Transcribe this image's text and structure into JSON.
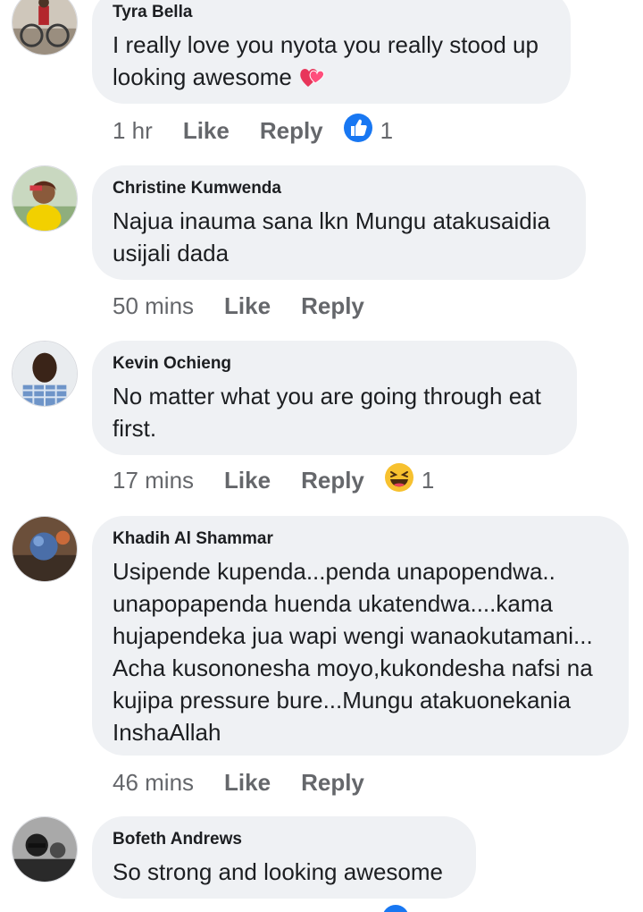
{
  "comments": [
    {
      "author": "Tyra Bella",
      "lines": [
        "I really love you nyota you really stood up",
        "looking awesome"
      ],
      "inline_emoji": "heart-icon",
      "time": "1 hr",
      "like_label": "Like",
      "reply_label": "Reply",
      "reaction": "like-icon",
      "reaction_count": "1"
    },
    {
      "author": "Christine Kumwenda",
      "lines": [
        "Najua inauma sana lkn Mungu atakusaidia",
        "usijali dada"
      ],
      "time": "50 mins",
      "like_label": "Like",
      "reply_label": "Reply"
    },
    {
      "author": "Kevin Ochieng",
      "lines": [
        "No matter what you are going through eat",
        "first."
      ],
      "time": "17 mins",
      "like_label": "Like",
      "reply_label": "Reply",
      "reaction": "haha-icon",
      "reaction_count": "1"
    },
    {
      "author": "Khadih Al Shammar",
      "lines": [
        "Usipende kupenda...penda unapopendwa..",
        "unapopapenda huenda ukatendwa....kama",
        "hujapendeka jua wapi wengi wanaokutamani...",
        "Acha kusononesha moyo,kukondesha nafsi na",
        "kujipa pressure bure...Mungu atakuonekania",
        "InshaAllah"
      ],
      "time": "46 mins",
      "like_label": "Like",
      "reply_label": "Reply"
    },
    {
      "author": "Bofeth Andrews",
      "lines": [
        "So strong and looking awesome"
      ]
    }
  ],
  "colors": {
    "bubble": "#eff1f4",
    "text": "#1c1e21",
    "meta": "#65676b",
    "like_blue": "#1877f2",
    "haha_yellow": "#f7c12f"
  }
}
